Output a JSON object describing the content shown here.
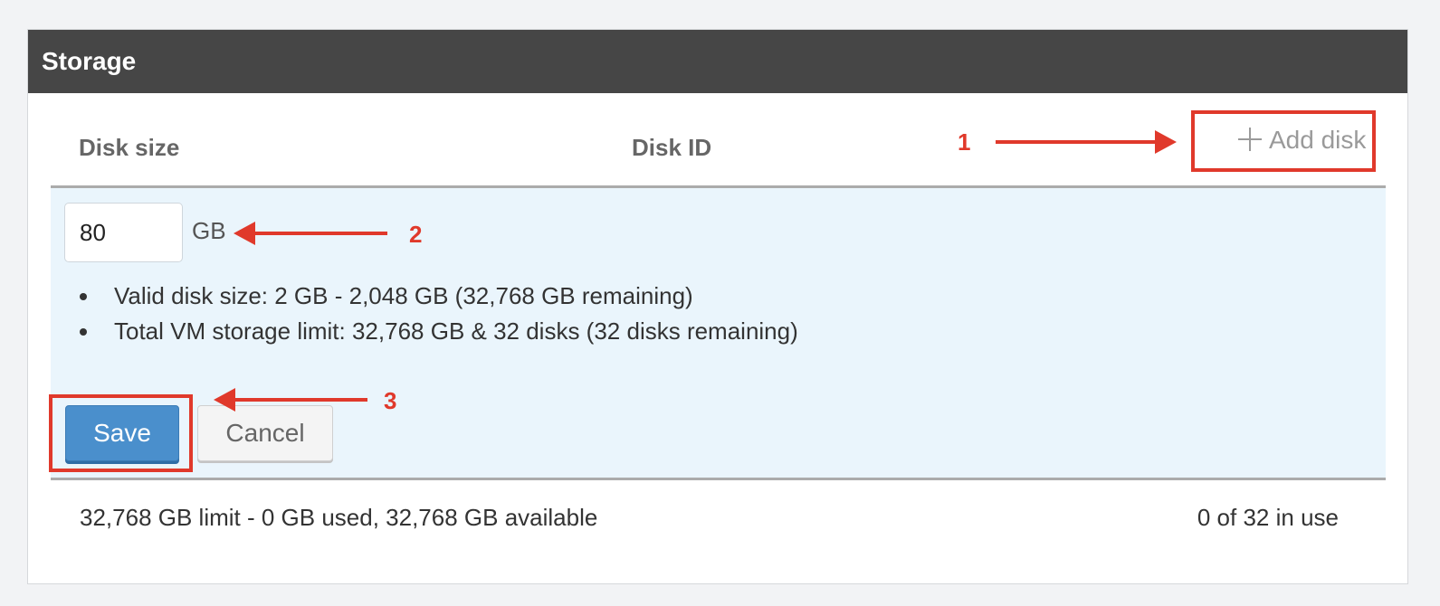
{
  "panel": {
    "title": "Storage"
  },
  "table": {
    "col_disk_size": "Disk size",
    "col_disk_id": "Disk ID",
    "add_disk_label": "Add disk",
    "add_disk_icon": "plus-icon"
  },
  "editor": {
    "size_value": "80",
    "unit": "GB",
    "notes": [
      "Valid disk size: 2 GB - 2,048 GB (32,768 GB remaining)",
      "Total VM storage limit: 32,768 GB & 32 disks (32 disks remaining)"
    ],
    "save_label": "Save",
    "cancel_label": "Cancel"
  },
  "footer": {
    "usage": "32,768 GB limit - 0 GB used, 32,768 GB available",
    "disks_in_use": "0 of 32 in use"
  },
  "annotations": {
    "n1": "1",
    "n2": "2",
    "n3": "3",
    "color": "#e0392b"
  },
  "colors": {
    "header_bg": "#464646",
    "edit_bg": "#eaf5fc",
    "save_bg": "#4a8fcc"
  }
}
